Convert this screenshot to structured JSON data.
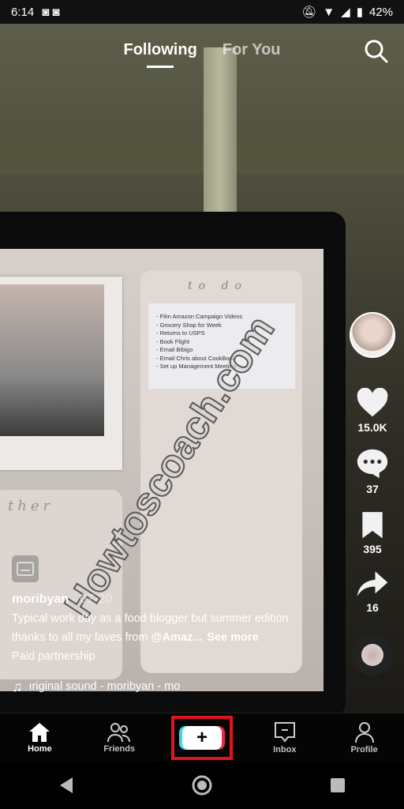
{
  "status": {
    "time": "6:14",
    "battery": "42%"
  },
  "header": {
    "tabs": [
      {
        "label": "Following",
        "active": true
      },
      {
        "label": "For You",
        "active": false
      }
    ]
  },
  "video": {
    "todo_title": "to do",
    "todo_items": [
      "- Film Amazon Campaign Videos",
      "- Grocery Shop for Week",
      "- Returns to USPS",
      "- Book Flight",
      "- Email Bibigo",
      "- Email Chris about CookBook",
      "- Set up Management Meeting"
    ],
    "card_text": "ther",
    "watermark": "Howtoscoach.com"
  },
  "actions": {
    "likes": "15.0K",
    "comments": "37",
    "saves": "395",
    "shares": "16"
  },
  "post": {
    "username": "moribyan",
    "date": " · 07-20",
    "caption": "Typical work day as a food blogger but summer edition thanks to all my faves from ",
    "mention": "@Amaz...",
    "see_more": "See more",
    "paid": "Paid partnership",
    "sound": "ıriginal sound - moribyan - mo"
  },
  "nav": {
    "home": "Home",
    "friends": "Friends",
    "create": "+",
    "inbox": "Inbox",
    "profile": "Profile"
  },
  "colors": {
    "highlight": "#e0141c",
    "create_cyan": "#38d9e5",
    "create_red": "#e8294f"
  }
}
